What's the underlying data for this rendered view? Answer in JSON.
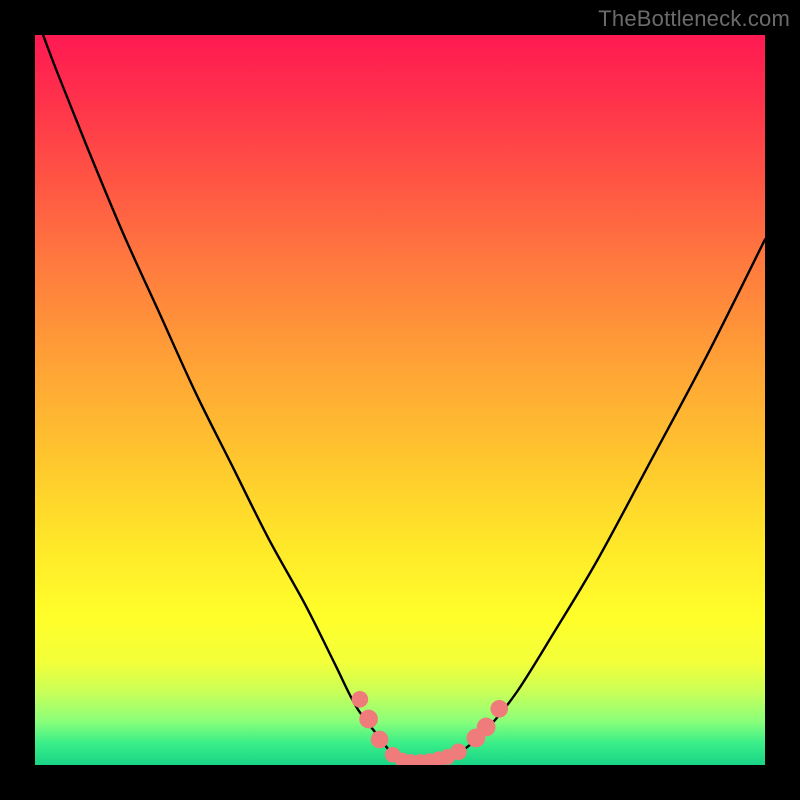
{
  "watermark": "TheBottleneck.com",
  "colors": {
    "background": "#000000",
    "curve": "#000000",
    "marker": "#ef7c7a",
    "gradient_stops": [
      "#ff1a52",
      "#ff2f4c",
      "#ff5544",
      "#ff7c3e",
      "#ffa236",
      "#ffc62e",
      "#ffe829",
      "#ffff2a",
      "#f2ff3a",
      "#c9ff58",
      "#8aff7a",
      "#3aee88",
      "#18d486"
    ]
  },
  "chart_data": {
    "type": "line",
    "title": "",
    "xlabel": "",
    "ylabel": "",
    "xlim": [
      0,
      100
    ],
    "ylim": [
      0,
      100
    ],
    "grid": false,
    "curve": {
      "name": "bottleneck-curve",
      "x": [
        0,
        3,
        7,
        12,
        17,
        22,
        27,
        32,
        37,
        41,
        44,
        47,
        49,
        51,
        53,
        55,
        57,
        59,
        62,
        66,
        71,
        77,
        84,
        92,
        100
      ],
      "y": [
        103,
        95,
        85,
        73,
        62,
        51,
        41,
        31,
        22,
        14,
        8,
        4,
        1.5,
        0.5,
        0.5,
        0.8,
        1.3,
        2.3,
        5,
        10,
        18,
        28,
        41,
        56,
        72
      ]
    },
    "markers": {
      "name": "highlight-points",
      "color": "#ef7c7a",
      "points": [
        {
          "x": 44.5,
          "y": 9.0,
          "r": 1.6
        },
        {
          "x": 45.7,
          "y": 6.3,
          "r": 1.8
        },
        {
          "x": 47.2,
          "y": 3.5,
          "r": 1.7
        },
        {
          "x": 49.0,
          "y": 1.4,
          "r": 1.5
        },
        {
          "x": 50.3,
          "y": 0.7,
          "r": 1.4
        },
        {
          "x": 51.5,
          "y": 0.5,
          "r": 1.4
        },
        {
          "x": 52.8,
          "y": 0.5,
          "r": 1.4
        },
        {
          "x": 54.0,
          "y": 0.6,
          "r": 1.4
        },
        {
          "x": 55.3,
          "y": 0.8,
          "r": 1.5
        },
        {
          "x": 56.5,
          "y": 1.1,
          "r": 1.5
        },
        {
          "x": 58.0,
          "y": 1.8,
          "r": 1.6
        },
        {
          "x": 60.4,
          "y": 3.7,
          "r": 1.8
        },
        {
          "x": 61.8,
          "y": 5.2,
          "r": 1.8
        },
        {
          "x": 63.6,
          "y": 7.7,
          "r": 1.7
        }
      ]
    }
  }
}
